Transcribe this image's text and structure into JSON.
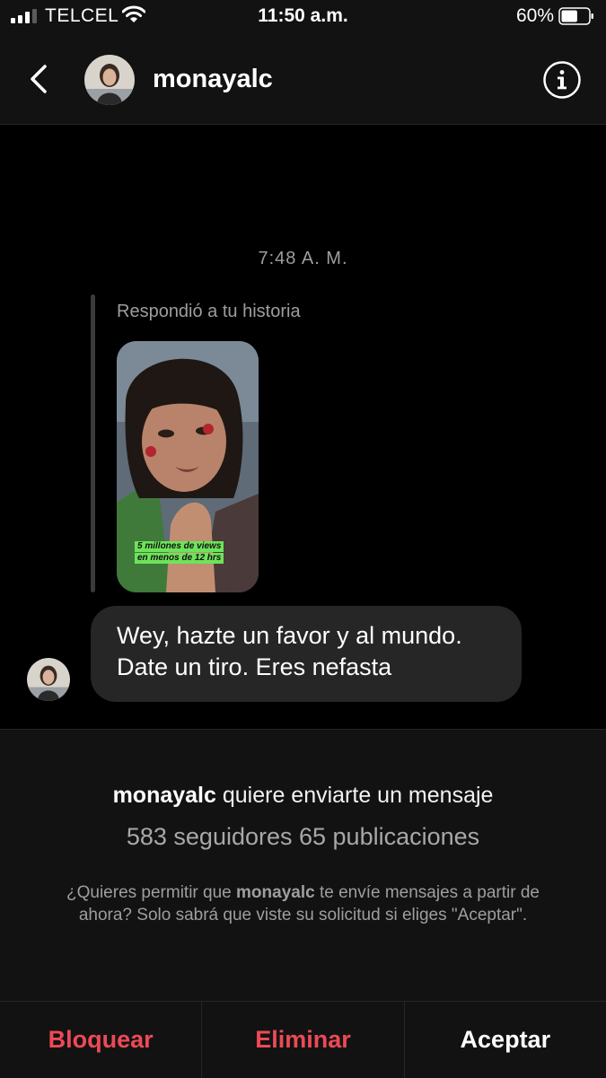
{
  "status_bar": {
    "carrier": "TELCEL",
    "time": "11:50 a.m.",
    "battery_percent": "60%",
    "battery_level": 0.6,
    "icons": [
      "signal-icon",
      "wifi-icon",
      "battery-icon"
    ]
  },
  "header": {
    "username": "monayalc",
    "icons": [
      "chevron-left-icon",
      "info-icon"
    ]
  },
  "chat": {
    "timestamp": "7:48 A. M.",
    "reply_label": "Respondió a tu historia",
    "story_caption_line1": "5 millones de views",
    "story_caption_line2": "en menos de 12 hrs",
    "message_line1": "Wey, hazte un favor y al mundo.",
    "message_line2": "Date un tiro. Eres nefasta"
  },
  "request": {
    "username": "monayalc",
    "title_suffix": " quiere enviarte un mensaje",
    "stats": "583 seguidores 65 publicaciones",
    "desc_prefix": "¿Quieres permitir que ",
    "desc_username": "monayalc",
    "desc_suffix": " te envíe mensajes a partir de ahora? Solo sabrá que viste su solicitud si eliges \"Aceptar\"."
  },
  "actions": {
    "block_label": "Bloquear",
    "delete_label": "Eliminar",
    "accept_label": "Aceptar"
  },
  "colors": {
    "background": "#000000",
    "bar": "#121212",
    "bubble": "#262626",
    "danger": "#ed4956",
    "muted": "#9e9e9e"
  }
}
